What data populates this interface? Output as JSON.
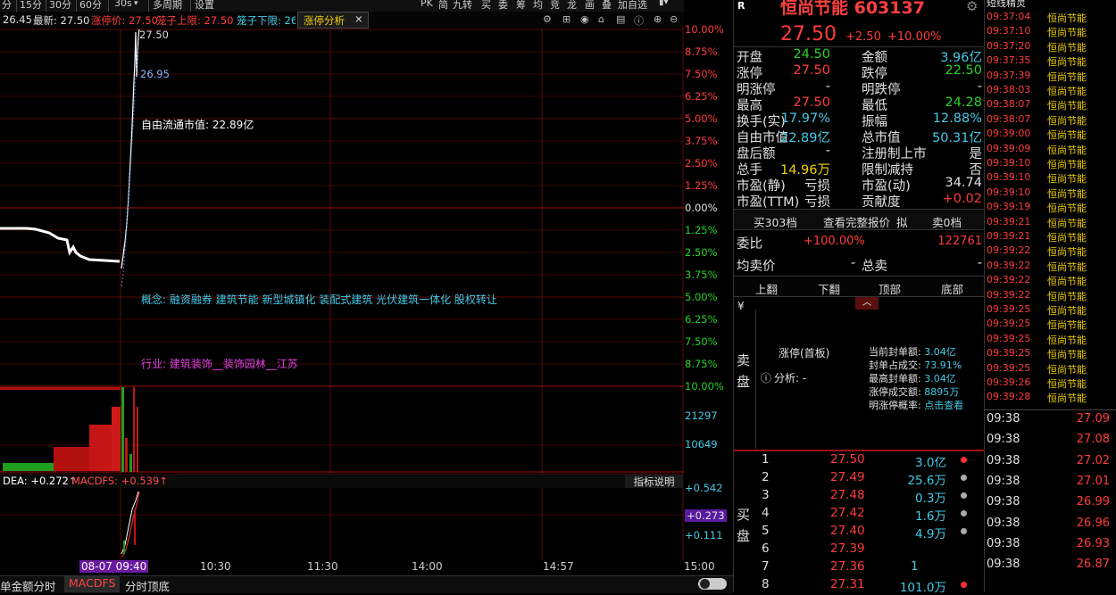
{
  "toolbar": {
    "items": [
      "分",
      "15分",
      "30分",
      "60分",
      "30s",
      "多周期",
      "设置"
    ],
    "right_items": [
      "PK",
      "简",
      "九转",
      "买",
      "委",
      "筹",
      "均",
      "竞",
      "龙",
      "画",
      "叠",
      "加自选"
    ]
  },
  "infobar": {
    "open_price_label": "26.45",
    "latest_label": "最新: 27.50",
    "limit_up_label": "涨停价: 27.50",
    "cage_upper_label": "笼子上限: 27.50",
    "cage_lower_label": "笼子下限: 26",
    "tab_label": "涨停分析",
    "close_glyph": "×"
  },
  "chart_labels": {
    "price_high": "27.50",
    "price_mid": "26.95",
    "float_value": "自由流通市值: 22.89亿",
    "concepts": "概念: 融资融券  建筑节能  新型城镇化  装配式建筑  光伏建筑一体化  股权转让",
    "industry": "行业: 建筑装饰__装饰园林__江苏",
    "dea": "DEA: +0.272↑",
    "macdfs": "MACDFS: +0.539↑",
    "indicator_btn": "指标说明"
  },
  "axis_pct": [
    "10.00%",
    "8.75%",
    "7.50%",
    "6.25%",
    "5.00%",
    "3.75%",
    "2.50%",
    "1.25%",
    "0.00%",
    "1.25%",
    "2.50%",
    "3.75%",
    "5.00%",
    "6.25%",
    "7.50%",
    "8.75%",
    "10.00%"
  ],
  "axis_vol": [
    "21297",
    "10649"
  ],
  "axis_macd": [
    "+0.542",
    "+0.273",
    "+0.111"
  ],
  "time_axis": [
    "08-07 09:40",
    "10:30",
    "11:30",
    "14:00",
    "14:57",
    "15:00"
  ],
  "bottom_tabs": [
    "单金额分时",
    "MACDFS",
    "分时顶底"
  ],
  "stock": {
    "market_flag": "R",
    "name_code": "恒尚节能 603137",
    "price": "27.50",
    "change": "+2.50",
    "change_pct": "+10.00%"
  },
  "quote_rows": [
    {
      "l1": "开盘",
      "v1": "24.50",
      "l2": "金额",
      "v2": "3.96亿"
    },
    {
      "l1": "涨停",
      "v1": "27.50",
      "l2": "跌停",
      "v2": "22.50"
    },
    {
      "l1": "明涨停",
      "v1": "-",
      "l2": "明跌停",
      "v2": "-"
    },
    {
      "l1": "最高",
      "v1": "27.50",
      "l2": "最低",
      "v2": "24.28"
    },
    {
      "l1": "换手(实)",
      "v1": "17.97%",
      "l2": "振幅",
      "v2": "12.88%"
    },
    {
      "l1": "自由市值",
      "v1": "22.89亿",
      "l2": "总市值",
      "v2": "50.31亿"
    },
    {
      "l1": "盘后额",
      "v1": "-",
      "l2": "注册制上市",
      "v2": "是"
    },
    {
      "l1": "总手",
      "v1": "14.96万",
      "l2": "限制减持",
      "v2": "否"
    },
    {
      "l1": "市盈(静)",
      "v1": "亏损",
      "l2": "市盈(动)",
      "v2": "34.74"
    },
    {
      "l1": "市盈(TTM)",
      "v1": "亏损",
      "l2": "贡献度",
      "v2": "+0.02"
    }
  ],
  "depth_buttons": [
    "买303档",
    "查看完整报价",
    "拟",
    "卖0档"
  ],
  "weibi": {
    "label": "委比",
    "pct": "+100.00%",
    "value": "122761"
  },
  "avg_row": {
    "label": "均卖价",
    "v1": "-",
    "mid": "总卖",
    "v2": "-"
  },
  "nav_buttons": [
    "上翻",
    "下翻",
    "顶部",
    "底部"
  ],
  "sell_side": {
    "yen": "¥",
    "label": "卖盘"
  },
  "limit_info": {
    "title": "涨停(首板)",
    "analysis": "分析: -",
    "lines": [
      {
        "k": "当前封单额:",
        "v": "3.04亿"
      },
      {
        "k": "封单占成交:",
        "v": "73.91%"
      },
      {
        "k": "最高封单额:",
        "v": "3.04亿"
      },
      {
        "k": "涨停成交额:",
        "v": "8895万"
      },
      {
        "k": "明涨停概率:",
        "v": "点击查看"
      }
    ]
  },
  "buy_side": {
    "label": "买盘"
  },
  "buy_orders": [
    {
      "n": "1",
      "price": "27.50",
      "vol": "3.0亿"
    },
    {
      "n": "2",
      "price": "27.49",
      "vol": "25.6万"
    },
    {
      "n": "3",
      "price": "27.48",
      "vol": "0.3万"
    },
    {
      "n": "4",
      "price": "27.42",
      "vol": "1.6万"
    },
    {
      "n": "5",
      "price": "27.40",
      "vol": "4.9万"
    },
    {
      "n": "6",
      "price": "27.39",
      "vol": ""
    },
    {
      "n": "7",
      "price": "27.36",
      "vol": "1"
    },
    {
      "n": "8",
      "price": "27.31",
      "vol": "101.0万"
    }
  ],
  "ticks_header": "短线精灵",
  "ticks": [
    {
      "t": "09:37:04",
      "s": "恒尚节能"
    },
    {
      "t": "09:37:10",
      "s": "恒尚节能"
    },
    {
      "t": "09:37:20",
      "s": "恒尚节能"
    },
    {
      "t": "09:37:35",
      "s": "恒尚节能"
    },
    {
      "t": "09:37:39",
      "s": "恒尚节能"
    },
    {
      "t": "09:38:03",
      "s": "恒尚节能"
    },
    {
      "t": "09:38:07",
      "s": "恒尚节能"
    },
    {
      "t": "09:38:07",
      "s": "恒尚节能"
    },
    {
      "t": "09:39:00",
      "s": "恒尚节能"
    },
    {
      "t": "09:39:09",
      "s": "恒尚节能"
    },
    {
      "t": "09:39:10",
      "s": "恒尚节能"
    },
    {
      "t": "09:39:10",
      "s": "恒尚节能"
    },
    {
      "t": "09:39:10",
      "s": "恒尚节能"
    },
    {
      "t": "09:39:19",
      "s": "恒尚节能"
    },
    {
      "t": "09:39:21",
      "s": "恒尚节能"
    },
    {
      "t": "09:39:21",
      "s": "恒尚节能"
    },
    {
      "t": "09:39:22",
      "s": "恒尚节能"
    },
    {
      "t": "09:39:22",
      "s": "恒尚节能"
    },
    {
      "t": "09:39:22",
      "s": "恒尚节能"
    },
    {
      "t": "09:39:22",
      "s": "恒尚节能"
    },
    {
      "t": "09:39:25",
      "s": "恒尚节能"
    },
    {
      "t": "09:39:25",
      "s": "恒尚节能"
    },
    {
      "t": "09:39:25",
      "s": "恒尚节能"
    },
    {
      "t": "09:39:25",
      "s": "恒尚节能"
    },
    {
      "t": "09:39:25",
      "s": "恒尚节能"
    },
    {
      "t": "09:39:26",
      "s": "恒尚节能"
    },
    {
      "t": "09:39:28",
      "s": "恒尚节能"
    }
  ],
  "trades": [
    {
      "t": "09:38",
      "p": "27.09"
    },
    {
      "t": "09:38",
      "p": "27.08"
    },
    {
      "t": "09:38",
      "p": "27.02"
    },
    {
      "t": "09:38",
      "p": "27.01"
    },
    {
      "t": "09:38",
      "p": "26.99"
    },
    {
      "t": "09:38",
      "p": "26.96"
    },
    {
      "t": "09:38",
      "p": "26.93"
    },
    {
      "t": "09:38",
      "p": "26.87"
    }
  ],
  "colors": {
    "up": "#ff3b3b",
    "down": "#27d227",
    "grid": "#5a0a0a",
    "accent": "#f0d000"
  }
}
